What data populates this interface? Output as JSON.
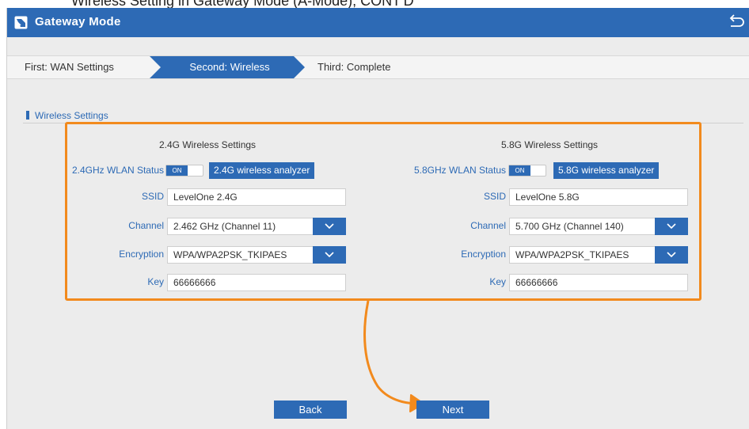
{
  "caption": "Wireless Setting in Gateway Mode (A-Mode), CONT'D",
  "app": {
    "title": "Gateway Mode"
  },
  "steps": [
    {
      "label": "First: WAN Settings"
    },
    {
      "label": "Second: Wireless"
    },
    {
      "label": "Third: Complete"
    }
  ],
  "section": {
    "title": "Wireless Settings"
  },
  "band24": {
    "title": "2.4G Wireless Settings",
    "status_label": "2.4GHz WLAN Status",
    "status_toggle": "ON",
    "analyzer": "2.4G wireless analyzer",
    "ssid_label": "SSID",
    "ssid_value": "LevelOne 2.4G",
    "channel_label": "Channel",
    "channel_value": "2.462 GHz (Channel 11)",
    "encryption_label": "Encryption",
    "encryption_value": "WPA/WPA2PSK_TKIPAES",
    "key_label": "Key",
    "key_value": "66666666"
  },
  "band58": {
    "title": "5.8G Wireless Settings",
    "status_label": "5.8GHz WLAN Status",
    "status_toggle": "ON",
    "analyzer": "5.8G wireless analyzer",
    "ssid_label": "SSID",
    "ssid_value": "LevelOne 5.8G",
    "channel_label": "Channel",
    "channel_value": "5.700 GHz (Channel 140)",
    "encryption_label": "Encryption",
    "encryption_value": "WPA/WPA2PSK_TKIPAES",
    "key_label": "Key",
    "key_value": "66666666"
  },
  "buttons": {
    "back": "Back",
    "next": "Next"
  },
  "colors": {
    "accent": "#2d6ab5",
    "annotation": "#f28a1d",
    "background": "#ececec"
  }
}
